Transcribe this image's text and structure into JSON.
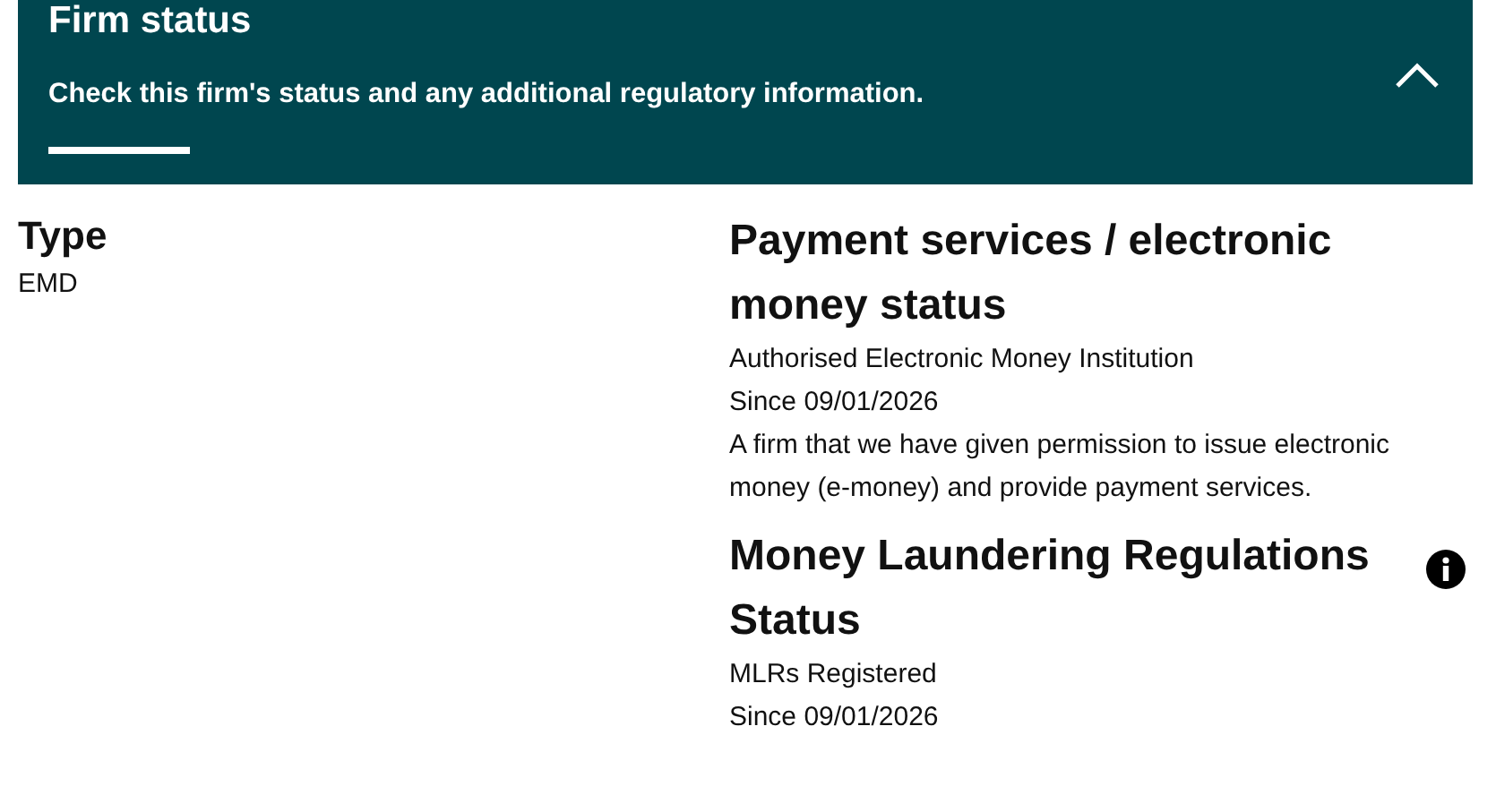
{
  "panel": {
    "title": "Firm status",
    "subtitle": "Check this firm's status and any additional regulatory information.",
    "expanded": true
  },
  "type": {
    "heading": "Type",
    "value": "EMD"
  },
  "statuses": [
    {
      "heading": "Payment services / electronic money status",
      "lines": [
        "Authorised Electronic Money Institution",
        "Since 09/01/2026",
        "A firm that we have given permission to issue electronic money (e-money) and provide payment services."
      ],
      "info": false
    },
    {
      "heading": "Money Laundering Regulations Status",
      "lines": [
        "MLRs Registered",
        "Since 09/01/2026"
      ],
      "info": true
    }
  ]
}
